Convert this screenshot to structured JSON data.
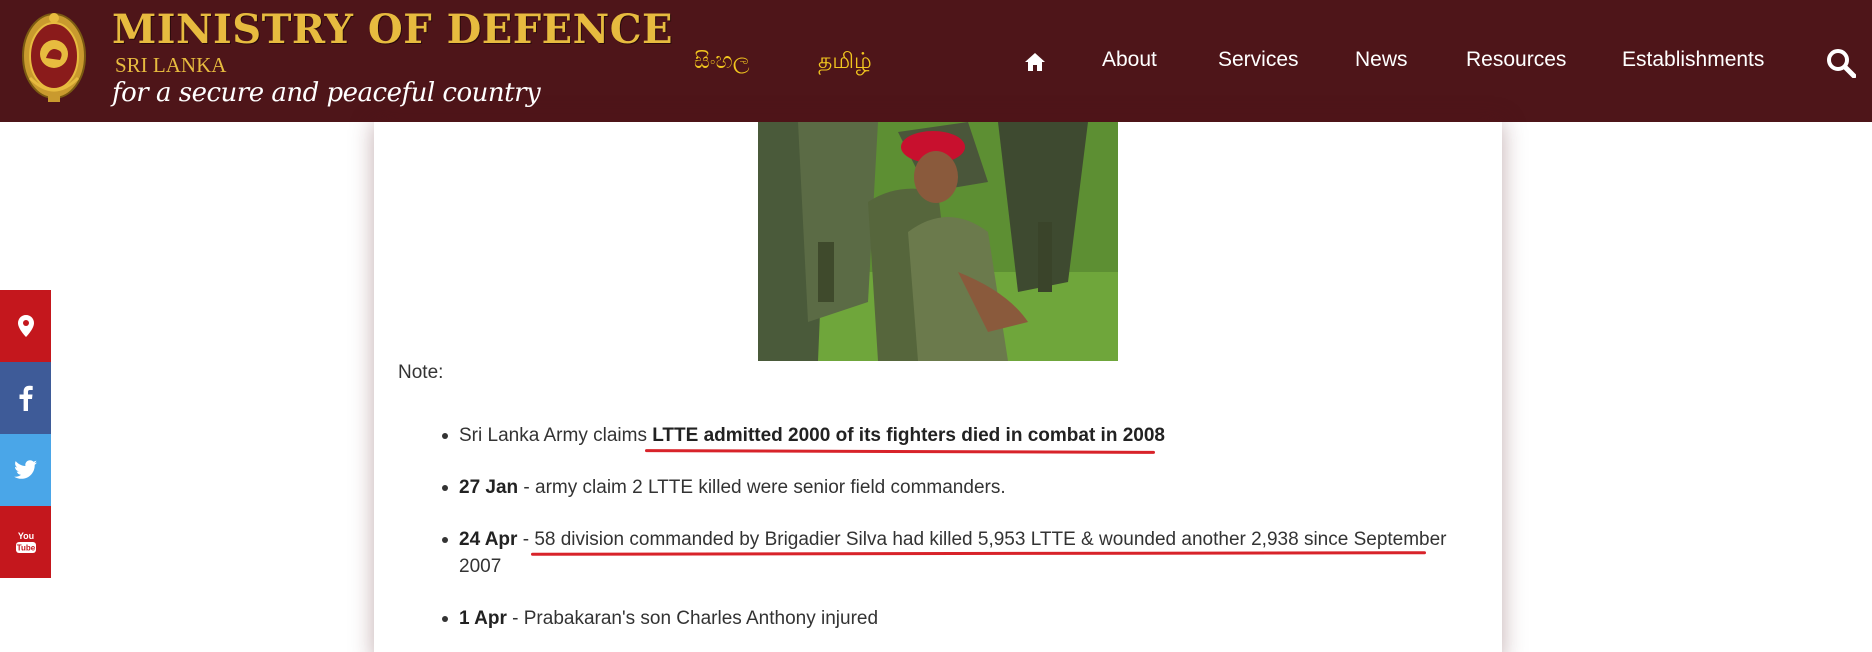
{
  "header": {
    "brand_title": "MINISTRY OF DEFENCE",
    "brand_country": "SRI LANKA",
    "brand_tagline": "for a secure and peaceful country",
    "languages": [
      "සිංහල",
      "தமிழ்"
    ],
    "nav": {
      "home_icon": "home-icon",
      "items": [
        "About",
        "Services",
        "News",
        "Resources",
        "Establishments"
      ],
      "search_icon": "search-icon"
    },
    "colors": {
      "background": "#4e1519",
      "gold": "#e7bb3f",
      "language": "#f3c71f"
    }
  },
  "social_bar": {
    "icons": [
      "location-pin-icon",
      "facebook-icon",
      "twitter-icon",
      "youtube-icon"
    ],
    "youtube_label": {
      "line1": "You",
      "line2": "Tube"
    }
  },
  "article": {
    "note_label": "Note:",
    "bullets": [
      {
        "pre": "Sri Lanka Army claims ",
        "bold": "LTTE admitted 2000 of its fighters died in combat in 2008"
      },
      {
        "bold": "27 Jan",
        "text": " - army claim 2 LTTE killed were senior field commanders."
      },
      {
        "bold": "24 Apr",
        "text": " - ",
        "underlined": "58 division commanded by Brigadier Silva had killed 5,953 LTTE & wounded another 2,938 since September",
        "text2": " 2007"
      },
      {
        "bold": "1 Apr",
        "text": " - Prabakaran's son Charles Anthony injured"
      }
    ],
    "annotation_color": "#d8232a"
  }
}
